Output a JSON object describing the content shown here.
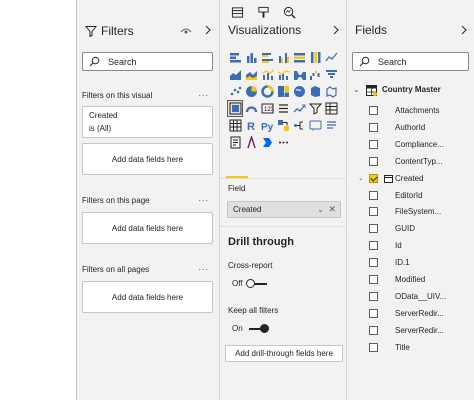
{
  "filters_pane": {
    "title": "Filters",
    "search_placeholder": "Search",
    "on_visual_label": "Filters on this visual",
    "visual_filter": {
      "name": "Created",
      "value": "is (All)"
    },
    "add_fields": "Add data fields here",
    "on_page_label": "Filters on this page",
    "on_all_pages_label": "Filters on all pages",
    "more": "..."
  },
  "viz_pane": {
    "title": "Visualizations",
    "visual_icons": [
      "stacked-bar-icon",
      "stacked-column-icon",
      "clustered-bar-icon",
      "clustered-column-icon",
      "100-bar-icon",
      "100-column-icon",
      "line-chart-icon",
      "area-chart-icon",
      "stacked-area-icon",
      "line-column-icon",
      "line-clustered-icon",
      "ribbon-chart-icon",
      "waterfall-icon",
      "funnel-icon",
      "scatter-icon",
      "pie-chart-icon",
      "donut-chart-icon",
      "treemap-icon",
      "map-icon",
      "filled-map-icon",
      "shape-map-icon",
      "azure-map-icon",
      "gauge-icon",
      "card-icon",
      "multirow-card-icon",
      "kpi-icon",
      "slicer-icon",
      "table-icon",
      "matrix-icon",
      "r-visual-icon",
      "python-visual-icon",
      "key-influencers-icon",
      "decomposition-tree-icon",
      "qa-icon",
      "smart-narrative-icon",
      "paginated-icon",
      "power-apps-icon",
      "power-automate-icon",
      "more-visuals-icon"
    ],
    "selected_icon_index": 21,
    "field_label": "Field",
    "field_value": "Created",
    "drill_title": "Drill through",
    "cross_report_label": "Cross-report",
    "cross_report_state": "Off",
    "keep_filters_label": "Keep all filters",
    "keep_filters_state": "On",
    "add_drill_fields": "Add drill-through fields here"
  },
  "fields_pane": {
    "title": "Fields",
    "search_placeholder": "Search",
    "table_name": "Country Master",
    "fields": [
      {
        "name": "Attachments",
        "checked": false,
        "expandable": false
      },
      {
        "name": "AuthorId",
        "checked": false,
        "expandable": false
      },
      {
        "name": "Compliance...",
        "checked": false,
        "expandable": false
      },
      {
        "name": "ContentTyp...",
        "checked": false,
        "expandable": false
      },
      {
        "name": "Created",
        "checked": true,
        "expandable": true
      },
      {
        "name": "EditorId",
        "checked": false,
        "expandable": false
      },
      {
        "name": "FileSystem...",
        "checked": false,
        "expandable": false
      },
      {
        "name": "GUID",
        "checked": false,
        "expandable": false
      },
      {
        "name": "Id",
        "checked": false,
        "expandable": false
      },
      {
        "name": "ID.1",
        "checked": false,
        "expandable": false
      },
      {
        "name": "Modified",
        "checked": false,
        "expandable": false
      },
      {
        "name": "OData__UIV...",
        "checked": false,
        "expandable": false
      },
      {
        "name": "ServerRedir...",
        "checked": false,
        "expandable": false
      },
      {
        "name": "ServerRedir...",
        "checked": false,
        "expandable": false
      },
      {
        "name": "Title",
        "checked": false,
        "expandable": false
      }
    ]
  },
  "colors": {
    "accent": "#f2c811",
    "pane_bg": "#f3f2f1",
    "border": "#c8c6c4"
  }
}
